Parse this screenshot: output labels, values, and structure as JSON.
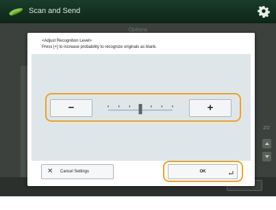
{
  "app": {
    "title": "Scan and Send",
    "icon": "scan-send-arrow-icon",
    "settings_icon": "gear-icon",
    "accent": "#1a3d2b"
  },
  "background": {
    "title": "Options",
    "page_indicator": "2/2",
    "scroll_up_icon": "triangle-up-icon",
    "scroll_down_icon": "triangle-down-icon"
  },
  "dialog": {
    "title": "<Adjust Recognition Level>",
    "description": "Press [+] to increase probability to recognize originals as blank.",
    "minus_label": "−",
    "plus_label": "+",
    "slider": {
      "min": 1,
      "max": 7,
      "value": 4
    },
    "cancel_label": "Cancel Settings",
    "cancel_icon": "close-x-icon",
    "ok_label": "OK",
    "ok_icon": "enter-return-icon",
    "highlight_color": "#f0a215"
  }
}
